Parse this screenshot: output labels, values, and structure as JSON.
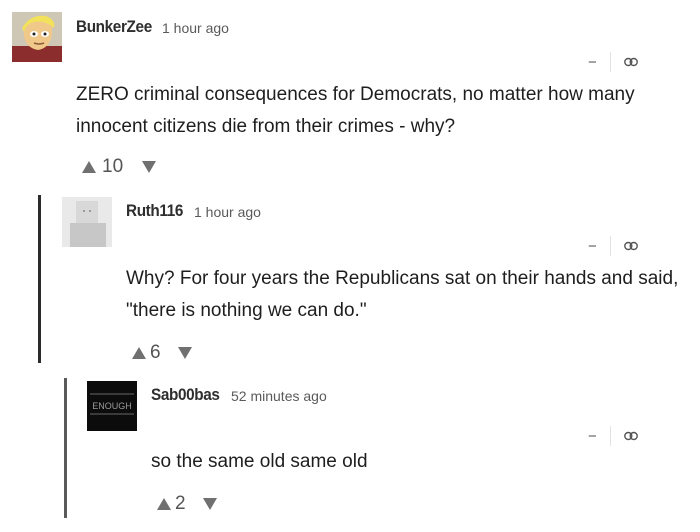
{
  "comments": [
    {
      "author": "BunkerZee",
      "time": "1 hour ago",
      "collapse": "−",
      "text": "ZERO criminal consequences for Democrats, no matter how many innocent citizens die from their crimes - why?",
      "votes": "10"
    },
    {
      "author": "Ruth116",
      "time": "1 hour ago",
      "collapse": "−",
      "text": "Why?  For four years the Republicans sat on their hands and said, \"there is nothing we can do.\"",
      "votes": "6"
    },
    {
      "author": "Sab00bas",
      "time": "52 minutes ago",
      "collapse": "−",
      "text": "so the same old same old",
      "votes": "2",
      "avatar_text": "ENOUGH"
    }
  ],
  "colors": {
    "thread_bar_1": "#2b2b2b",
    "thread_bar_2": "#5a5a5a",
    "vote_icon": "#707070"
  },
  "icons": {
    "collapse": "minus-icon",
    "permalink": "link-icon",
    "upvote": "triangle-up-icon",
    "downvote": "triangle-down-icon"
  }
}
